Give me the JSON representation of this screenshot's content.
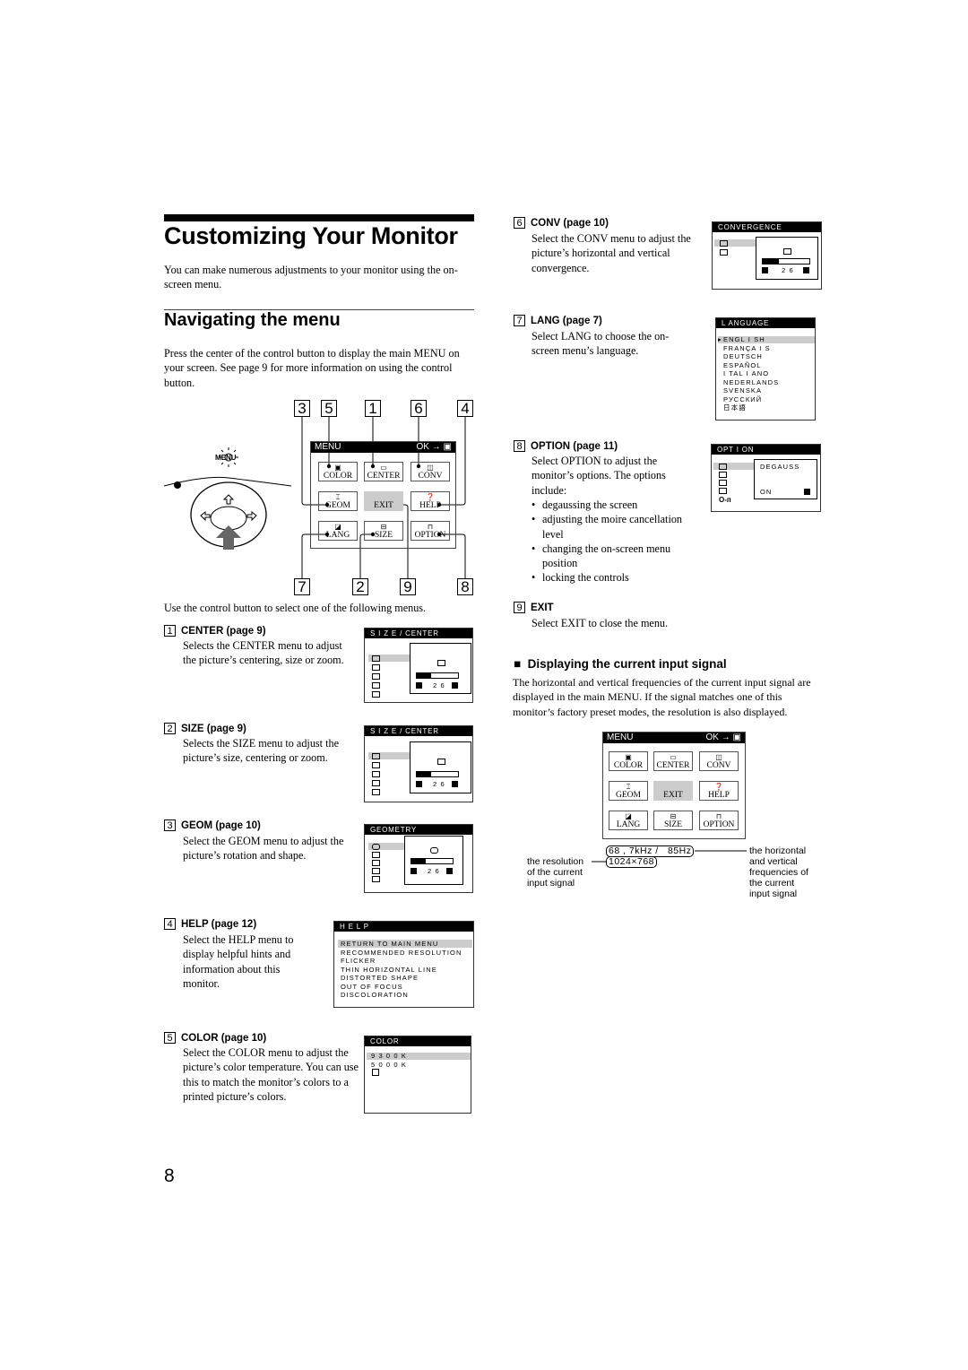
{
  "page": {
    "title": "Customizing Your Monitor",
    "intro": "You can make numerous adjustments to your monitor using the on-screen menu.",
    "section_title": "Navigating the menu",
    "section_intro": "Press the center of the control button to display the main MENU on your screen. See page 9 for more information on using the control button.",
    "select_instruction": "Use the control button to select one of the following menus.",
    "page_number": "8"
  },
  "diagram": {
    "control_label": "MENU",
    "callouts_top": [
      "3",
      "5",
      "1",
      "6",
      "4"
    ],
    "callouts_bottom": [
      "7",
      "2",
      "9",
      "8"
    ]
  },
  "main_menu": {
    "title": "MENU",
    "ok_label": "OK",
    "buttons": [
      {
        "label": "COLOR",
        "icon": "color-icon",
        "glyph": "▣"
      },
      {
        "label": "CENTER",
        "icon": "center-icon",
        "glyph": "▭"
      },
      {
        "label": "CONV",
        "icon": "conv-icon",
        "glyph": "◫"
      },
      {
        "label": "GEOM",
        "icon": "geom-icon",
        "glyph": "⌶"
      },
      {
        "label": "EXIT",
        "icon": "",
        "glyph": ""
      },
      {
        "label": "HELP",
        "icon": "help-icon",
        "glyph": "❓"
      },
      {
        "label": "LANG",
        "icon": "lang-icon",
        "glyph": "◪"
      },
      {
        "label": "SIZE",
        "icon": "size-icon",
        "glyph": "⊟"
      },
      {
        "label": "OPTION",
        "icon": "option-icon",
        "glyph": "⊓"
      }
    ]
  },
  "items": [
    {
      "num": "1",
      "title": "CENTER (page 9)",
      "text": "Selects the CENTER menu to adjust the picture’s centering, size or zoom.",
      "osd_title": "S I Z E / CENTER",
      "value": "2 6",
      "level": 0.35
    },
    {
      "num": "2",
      "title": "SIZE (page 9)",
      "text": "Selects the SIZE menu to adjust the picture’s size, centering or zoom.",
      "osd_title": "S I Z E / CENTER",
      "value": "2 6",
      "level": 0.35
    },
    {
      "num": "3",
      "title": "GEOM (page 10)",
      "text": "Select the GEOM menu to adjust the picture’s rotation and shape.",
      "osd_title": "GEOMETRY",
      "value": "2 6",
      "level": 0.35
    },
    {
      "num": "4",
      "title": "HELP (page 12)",
      "text": "Select the HELP menu to display helpful hints and information about this monitor.",
      "osd_title": "H E L P",
      "options": [
        "RETURN TO MAIN MENU",
        "RECOMMENDED RESOLUTION",
        "FLICKER",
        "THIN HORIZONTAL LINE",
        "DISTORTED SHAPE",
        "OUT OF FOCUS",
        "DISCOLORATION"
      ]
    },
    {
      "num": "5",
      "title": "COLOR (page 10)",
      "text": "Select the COLOR menu to adjust the picture’s color temperature. You can use this to match the monitor’s colors to a printed picture’s colors.",
      "osd_title": "COLOR",
      "options": [
        "9 3 0 0 K",
        "5 0 0 0 K"
      ]
    },
    {
      "num": "6",
      "title": "CONV (page 10)",
      "text": "Select the CONV menu to adjust the picture’s horizontal and vertical convergence.",
      "osd_title": "CONVERGENCE",
      "value": "2 6",
      "level": 0.35
    },
    {
      "num": "7",
      "title": "LANG (page 7)",
      "text": "Select LANG to choose the on-screen menu’s language.",
      "osd_title": "L ANGUAGE",
      "options": [
        "ENGL I SH",
        "FRANÇA I S",
        "DEUTSCH",
        "ESPAÑOL",
        "I TAL I ANO",
        "NEDERLANDS",
        "SVENSKA",
        "РУССКИЙ",
        "日本語"
      ]
    },
    {
      "num": "8",
      "title": "OPTION (page 11)",
      "text": "Select OPTION to adjust the monitor’s options. The options include:",
      "osd_title": "OPT I ON",
      "option_name": "DEGAUSS",
      "option_value": "ON",
      "bullets": [
        "degaussing the screen",
        "adjusting the moire cancellation level",
        "changing the on-screen menu position",
        "locking the controls"
      ]
    },
    {
      "num": "9",
      "title": "EXIT",
      "text": "Select EXIT to close the menu."
    }
  ],
  "signal": {
    "title": "Displaying the current input signal",
    "text": "The horizontal and vertical frequencies of the current input signal are displayed in the main MENU. If the signal matches one of this monitor’s factory preset modes, the resolution is also displayed.",
    "frequency": "68 , 7kHz /   85Hz",
    "resolution": "1024×768",
    "label_resolution": [
      "the resolution",
      "of the current",
      "input signal"
    ],
    "label_frequency": [
      "the horizontal",
      "and vertical",
      "frequencies of",
      "the current",
      "input signal"
    ]
  }
}
